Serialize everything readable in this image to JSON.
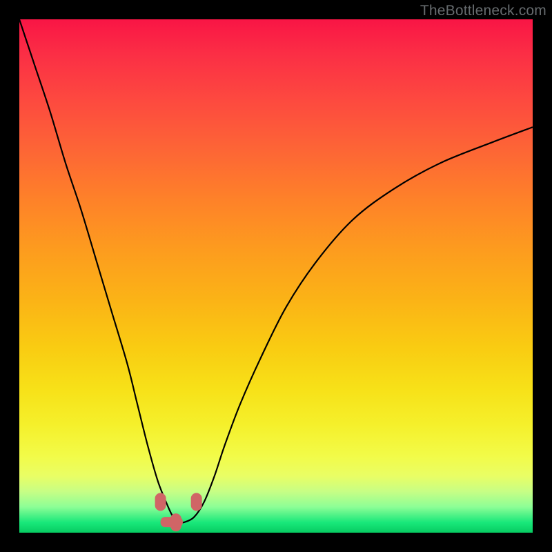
{
  "watermark": "TheBottleneck.com",
  "colors": {
    "frame": "#000000",
    "gradient_top": "#f91545",
    "gradient_bottom": "#07cc62",
    "curve_stroke": "#000000",
    "nub_fill": "#d06566"
  },
  "chart_data": {
    "type": "line",
    "title": "",
    "xlabel": "",
    "ylabel": "",
    "xlim": [
      0,
      100
    ],
    "ylim": [
      0,
      100
    ],
    "note": "no axis ticks or numeric labels are rendered; values are read as percent of plot area (0,0 = bottom-left)",
    "series": [
      {
        "name": "bottleneck-curve",
        "x": [
          0,
          3,
          6,
          9,
          12,
          15,
          18,
          21,
          23,
          25,
          27,
          29,
          30,
          31,
          32,
          34,
          36,
          38,
          40,
          43,
          47,
          52,
          58,
          65,
          73,
          82,
          92,
          100
        ],
        "y": [
          100,
          91,
          82,
          72,
          63,
          53,
          43,
          33,
          25,
          17,
          10,
          5,
          3,
          2,
          2,
          3,
          6,
          11,
          17,
          25,
          34,
          44,
          53,
          61,
          67,
          72,
          76,
          79
        ]
      }
    ],
    "markers": [
      {
        "name": "left-nub",
        "x": 27.5,
        "y": 6
      },
      {
        "name": "floor-nub",
        "x": 30.5,
        "y": 2
      },
      {
        "name": "right-nub",
        "x": 34.5,
        "y": 6
      }
    ]
  }
}
